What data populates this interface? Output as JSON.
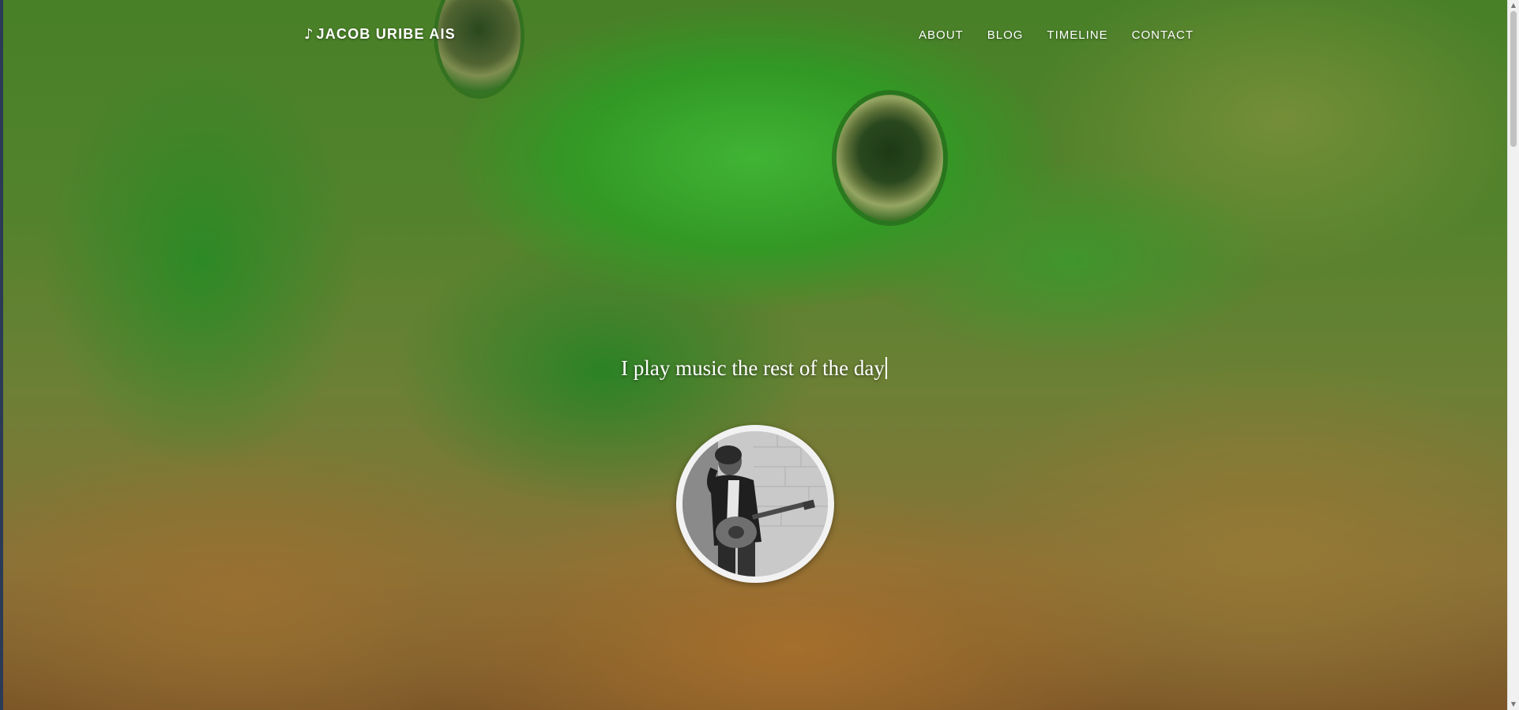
{
  "navbar": {
    "brand": {
      "icon": "music-note-icon",
      "icon_glyph": "♪",
      "title": "JACOB URIBE AIS"
    },
    "links": [
      {
        "label": "ABOUT"
      },
      {
        "label": "BLOG"
      },
      {
        "label": "TIMELINE"
      },
      {
        "label": "CONTACT"
      }
    ]
  },
  "hero": {
    "tagline": "I play music the rest of the day",
    "avatar": {
      "subject": "musician-with-guitar-grayscale"
    },
    "overlay_color": "#2e8b1f"
  },
  "colors": {
    "text": "#ffffff",
    "overlay_green": "#3aa02a",
    "wood_brown": "#b07a3c"
  }
}
